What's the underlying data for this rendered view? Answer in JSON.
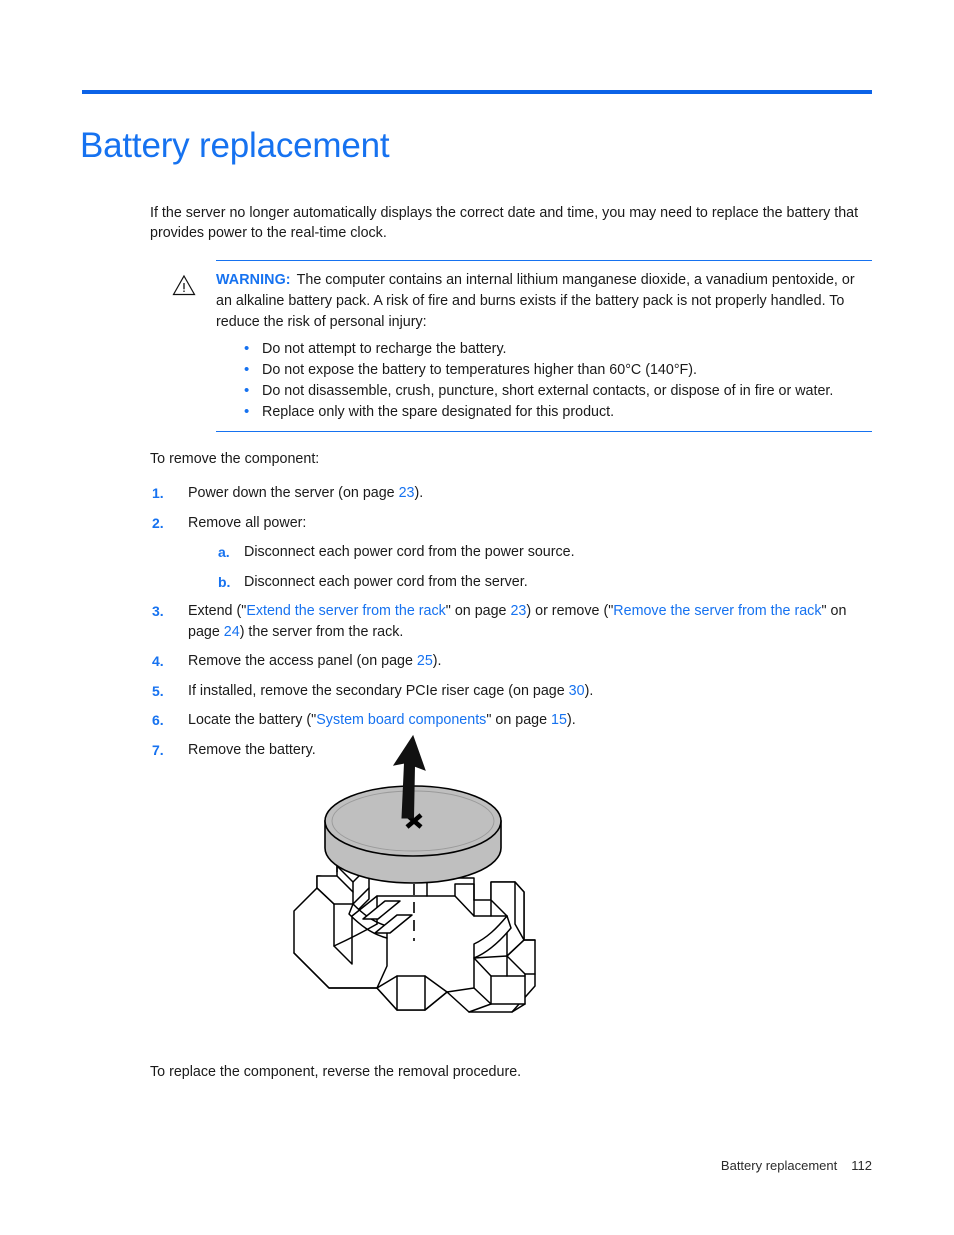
{
  "document": {
    "title": "Battery replacement",
    "accent_color": "#1672F0",
    "rule_color": "#0C63E7"
  },
  "intro": {
    "paragraph": "If the server no longer automatically displays the correct date and time, you may need to replace the battery that provides power to the real-time clock."
  },
  "warning": {
    "icon": "warning-triangle-icon",
    "label": "WARNING:",
    "text": "The computer contains an internal lithium manganese dioxide, a vanadium pentoxide, or an alkaline battery pack. A risk of fire and burns exists if the battery pack is not properly handled. To reduce the risk of personal injury:",
    "bullets": [
      "Do not attempt to recharge the battery.",
      "Do not expose the battery to temperatures higher than 60°C (140°F).",
      "Do not disassemble, crush, puncture, short external contacts, or dispose of in fire or water.",
      "Replace only with the spare designated for this product."
    ]
  },
  "procedure": {
    "lead_in": "To remove the component:",
    "steps": [
      {
        "number": "1.",
        "text_before": "Power down the server (on page ",
        "page_ref": "23",
        "text_after": ")."
      },
      {
        "number": "2.",
        "text_before": "Remove all power:",
        "substeps": [
          {
            "letter": "a.",
            "text": "Disconnect each power cord from the power source."
          },
          {
            "letter": "b.",
            "text": "Disconnect each power cord from the server."
          }
        ]
      },
      {
        "number": "3.",
        "seg1": "Extend (\"",
        "link1": "Extend the server from the rack",
        "seg2": "\" on page ",
        "page1": "23",
        "seg3": ") or remove (\"",
        "link2": "Remove the server from the rack",
        "seg4": "\" on page ",
        "page2": "24",
        "seg5": ") the server from the rack."
      },
      {
        "number": "4.",
        "text_before": "Remove the access panel (on page ",
        "page_ref": "25",
        "text_after": ")."
      },
      {
        "number": "5.",
        "text_before": "If installed, remove the secondary PCIe riser cage (on page ",
        "page_ref": "30",
        "text_after": ")."
      },
      {
        "number": "6.",
        "seg1": "Locate the battery (\"",
        "link1": "System board components",
        "seg2": "\" on page ",
        "page1": "15",
        "seg3": ")."
      },
      {
        "number": "7.",
        "text_before": "Remove the battery."
      }
    ]
  },
  "figure": {
    "name": "battery-removal-illustration",
    "description": "Exploded isometric line drawing of a coin cell battery being lifted out of its system board socket",
    "battery_fill": "#BFBFBF",
    "battery_mark": "X",
    "arrow": "up-arrow-removal-direction"
  },
  "closing": {
    "text": "To replace the component, reverse the removal procedure."
  },
  "footer": {
    "chapter": "Battery replacement",
    "page_number": "112"
  }
}
